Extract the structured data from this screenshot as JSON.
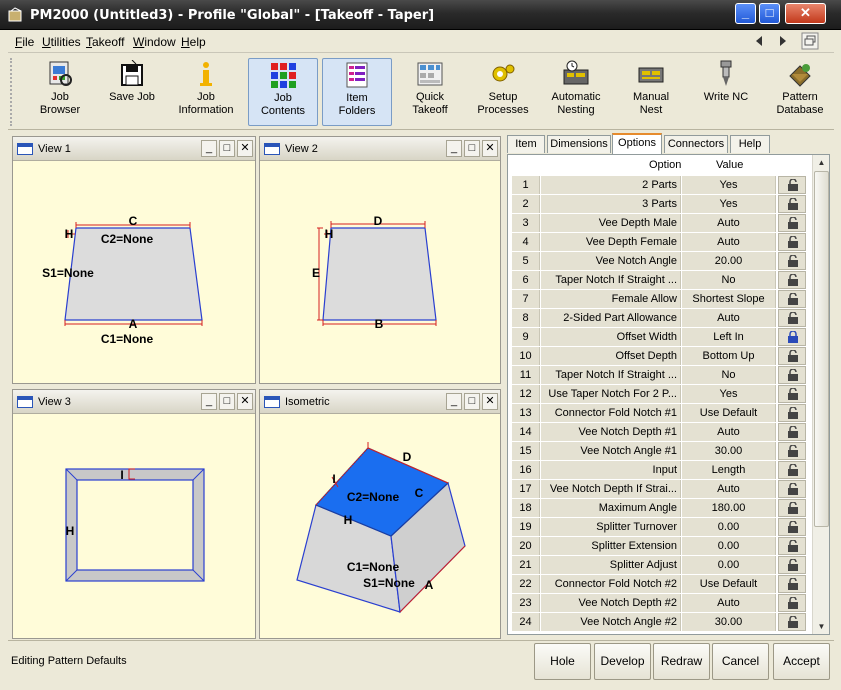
{
  "window": {
    "title": "PM2000 (Untitled3) - Profile \"Global\" - [Takeoff - Taper]",
    "min_label": "_",
    "max_label": "□",
    "close_label": "✕"
  },
  "menu": [
    "File",
    "Utilities",
    "Takeoff",
    "Window",
    "Help"
  ],
  "toolbar": [
    {
      "label1": "Job",
      "label2": "Browser",
      "icon": "job-browser-icon",
      "pressed": false
    },
    {
      "label1": "Save Job",
      "label2": "",
      "icon": "save-icon",
      "pressed": false
    },
    {
      "label1": "Job",
      "label2": "Information",
      "icon": "info-icon",
      "pressed": false
    },
    {
      "label1": "Job",
      "label2": "Contents",
      "icon": "job-contents-icon",
      "pressed": true
    },
    {
      "label1": "Item",
      "label2": "Folders",
      "icon": "item-folders-icon",
      "pressed": true
    },
    {
      "label1": "Quick",
      "label2": "Takeoff",
      "icon": "quick-takeoff-icon",
      "pressed": false
    },
    {
      "label1": "Setup",
      "label2": "Processes",
      "icon": "setup-processes-icon",
      "pressed": false
    },
    {
      "label1": "Automatic",
      "label2": "Nesting",
      "icon": "automatic-nesting-icon",
      "pressed": false
    },
    {
      "label1": "Manual",
      "label2": "Nest",
      "icon": "manual-nest-icon",
      "pressed": false
    },
    {
      "label1": "Write NC",
      "label2": "",
      "icon": "write-nc-icon",
      "pressed": false
    },
    {
      "label1": "Pattern",
      "label2": "Database",
      "icon": "pattern-database-icon",
      "pressed": false
    }
  ],
  "views": {
    "view1": {
      "title": "View 1",
      "labels": {
        "c": "C",
        "c2": "C2=None",
        "h": "H",
        "s1": "S1=None",
        "a": "A",
        "c1": "C1=None"
      }
    },
    "view2": {
      "title": "View 2",
      "labels": {
        "d": "D",
        "h": "H",
        "e": "E",
        "b": "B"
      }
    },
    "view3": {
      "title": "View 3",
      "labels": {
        "i": "I",
        "h": "H"
      }
    },
    "iso": {
      "title": "Isometric",
      "labels": {
        "d": "D",
        "i": "I",
        "c2": "C2=None",
        "c": "C",
        "h": "H",
        "c1": "C1=None",
        "s1": "S1=None",
        "a": "A"
      }
    }
  },
  "tabs": [
    "Item",
    "Dimensions",
    "Options",
    "Connectors",
    "Help"
  ],
  "active_tab": "Options",
  "grid": {
    "headers": {
      "option": "Option",
      "value": "Value"
    },
    "rows": [
      {
        "n": "1",
        "option": "2 Parts",
        "value": "Yes",
        "locked": false
      },
      {
        "n": "2",
        "option": "3 Parts",
        "value": "Yes",
        "locked": false
      },
      {
        "n": "3",
        "option": "Vee Depth Male",
        "value": "Auto",
        "locked": false
      },
      {
        "n": "4",
        "option": "Vee Depth Female",
        "value": "Auto",
        "locked": false
      },
      {
        "n": "5",
        "option": "Vee Notch Angle",
        "value": "20.00",
        "locked": false
      },
      {
        "n": "6",
        "option": "Taper Notch If Straight ...",
        "value": "No",
        "locked": false
      },
      {
        "n": "7",
        "option": "Female Allow",
        "value": "Shortest Slope",
        "locked": false
      },
      {
        "n": "8",
        "option": "2-Sided Part Allowance",
        "value": "Auto",
        "locked": false
      },
      {
        "n": "9",
        "option": "Offset Width",
        "value": "Left In",
        "locked": true
      },
      {
        "n": "10",
        "option": "Offset Depth",
        "value": "Bottom Up",
        "locked": false
      },
      {
        "n": "11",
        "option": "Taper Notch If Straight ...",
        "value": "No",
        "locked": false
      },
      {
        "n": "12",
        "option": "Use Taper Notch For 2 P...",
        "value": "Yes",
        "locked": false
      },
      {
        "n": "13",
        "option": "Connector Fold Notch #1",
        "value": "Use Default",
        "locked": false
      },
      {
        "n": "14",
        "option": "Vee Notch Depth #1",
        "value": "Auto",
        "locked": false
      },
      {
        "n": "15",
        "option": "Vee Notch Angle #1",
        "value": "30.00",
        "locked": false
      },
      {
        "n": "16",
        "option": "Input",
        "value": "Length",
        "locked": false
      },
      {
        "n": "17",
        "option": "Vee Notch Depth If Strai...",
        "value": "Auto",
        "locked": false
      },
      {
        "n": "18",
        "option": "Maximum Angle",
        "value": "180.00",
        "locked": false
      },
      {
        "n": "19",
        "option": "Splitter Turnover",
        "value": "0.00",
        "locked": false
      },
      {
        "n": "20",
        "option": "Splitter Extension",
        "value": "0.00",
        "locked": false
      },
      {
        "n": "21",
        "option": "Splitter Adjust",
        "value": "0.00",
        "locked": false
      },
      {
        "n": "22",
        "option": "Connector Fold Notch #2",
        "value": "Use Default",
        "locked": false
      },
      {
        "n": "23",
        "option": "Vee Notch Depth #2",
        "value": "Auto",
        "locked": false
      },
      {
        "n": "24",
        "option": "Vee Notch Angle #2",
        "value": "30.00",
        "locked": false
      }
    ]
  },
  "status": {
    "text": "Editing Pattern Defaults"
  },
  "actions": [
    "Hole",
    "Develop",
    "Redraw",
    "Cancel",
    "Accept"
  ],
  "colors": {
    "accent_tab": "#e68b2c",
    "shape_fill": "#dcdcdc",
    "shape_edge": "#2a3fd0",
    "dimension": "#d42020",
    "iso_top": "#1a6ef0",
    "view_bg": "#fffcd9"
  }
}
